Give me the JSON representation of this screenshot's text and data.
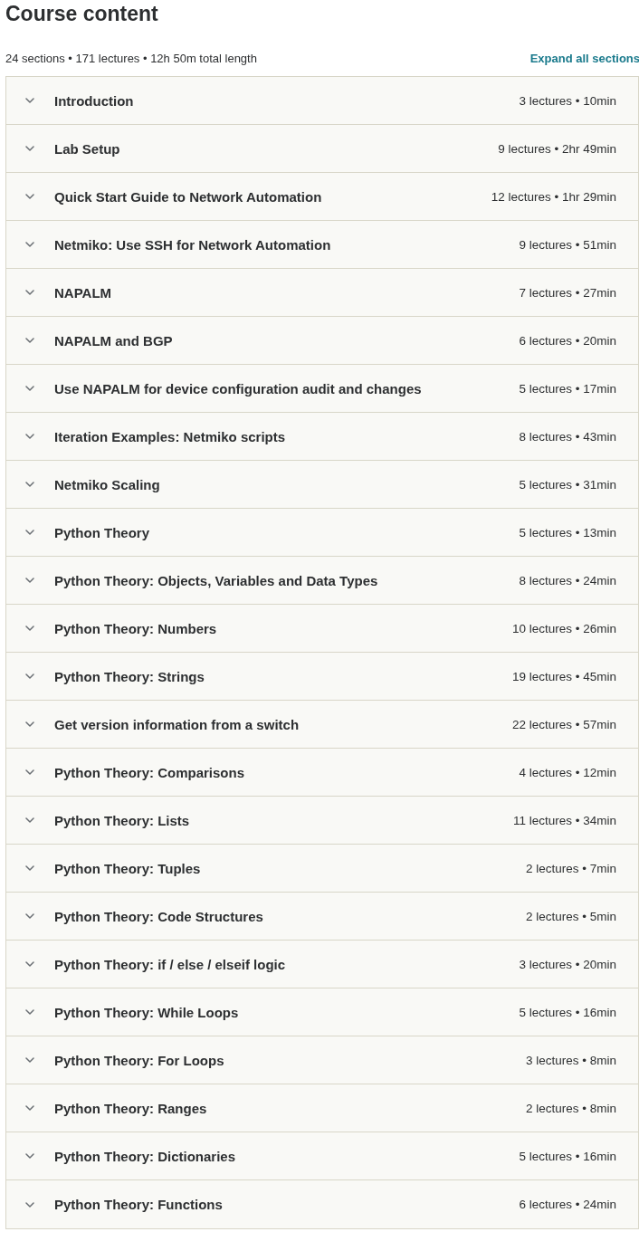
{
  "title": "Course content",
  "summary": "24 sections • 171 lectures • 12h 50m total length",
  "expand_link": "Expand all sections",
  "sections": [
    {
      "title": "Introduction",
      "meta": "3 lectures • 10min",
      "expanded": false
    },
    {
      "title": "Lab Setup",
      "meta": "9 lectures • 2hr 49min",
      "expanded": false
    },
    {
      "title": "Quick Start Guide to Network Automation",
      "meta": "12 lectures • 1hr 29min",
      "expanded": false
    },
    {
      "title": "Netmiko: Use SSH for Network Automation",
      "meta": "9 lectures • 51min",
      "expanded": false
    },
    {
      "title": "NAPALM",
      "meta": "7 lectures • 27min",
      "expanded": false
    },
    {
      "title": "NAPALM and BGP",
      "meta": "6 lectures • 20min",
      "expanded": false
    },
    {
      "title": "Use NAPALM for device configuration audit and changes",
      "meta": "5 lectures • 17min",
      "expanded": false
    },
    {
      "title": "Iteration Examples: Netmiko scripts",
      "meta": "8 lectures • 43min",
      "expanded": false
    },
    {
      "title": "Netmiko Scaling",
      "meta": "5 lectures • 31min",
      "expanded": false
    },
    {
      "title": "Python Theory",
      "meta": "5 lectures • 13min",
      "expanded": false
    },
    {
      "title": "Python Theory: Objects, Variables and Data Types",
      "meta": "8 lectures • 24min",
      "expanded": false
    },
    {
      "title": "Python Theory: Numbers",
      "meta": "10 lectures • 26min",
      "expanded": false
    },
    {
      "title": "Python Theory: Strings",
      "meta": "19 lectures • 45min",
      "expanded": false
    },
    {
      "title": "Get version information from a switch",
      "meta": "22 lectures • 57min",
      "expanded": false
    },
    {
      "title": "Python Theory: Comparisons",
      "meta": "4 lectures • 12min",
      "expanded": false
    },
    {
      "title": "Python Theory: Lists",
      "meta": "11 lectures • 34min",
      "expanded": false
    },
    {
      "title": "Python Theory: Tuples",
      "meta": "2 lectures • 7min",
      "expanded": false
    },
    {
      "title": "Python Theory: Code Structures",
      "meta": "2 lectures • 5min",
      "expanded": false
    },
    {
      "title": "Python Theory: if / else / elseif logic",
      "meta": "3 lectures • 20min",
      "expanded": false
    },
    {
      "title": "Python Theory: While Loops",
      "meta": "5 lectures • 16min",
      "expanded": false
    },
    {
      "title": "Python Theory: For Loops",
      "meta": "3 lectures • 8min",
      "expanded": false
    },
    {
      "title": "Python Theory: Ranges",
      "meta": "2 lectures • 8min",
      "expanded": false
    },
    {
      "title": "Python Theory: Dictionaries",
      "meta": "5 lectures • 16min",
      "expanded": false
    },
    {
      "title": "Python Theory: Functions",
      "meta": "6 lectures • 24min",
      "expanded": false
    }
  ]
}
